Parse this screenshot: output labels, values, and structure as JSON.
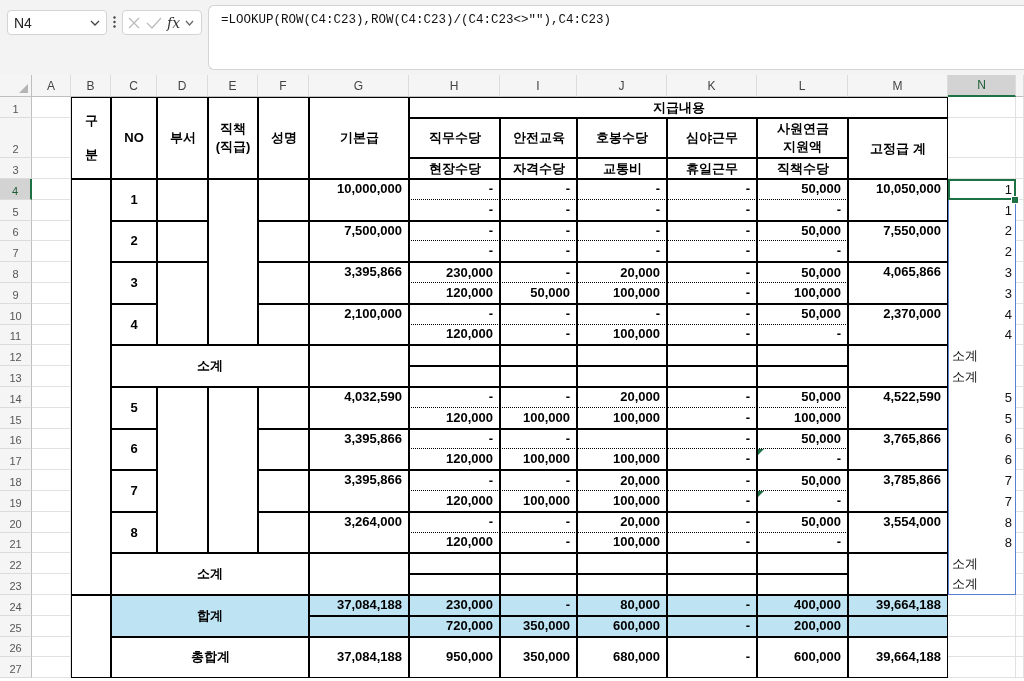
{
  "formula_bar": {
    "name_box": "N4",
    "function_label": "fx",
    "formula": "=LOOKUP(ROW(C4:C23),ROW(C4:C23)/(C4:C23<>\"\"),C4:C23)"
  },
  "column_headers": [
    {
      "label": "A",
      "selected": false
    },
    {
      "label": "B",
      "selected": false
    },
    {
      "label": "C",
      "selected": false
    },
    {
      "label": "D",
      "selected": false
    },
    {
      "label": "E",
      "selected": false
    },
    {
      "label": "F",
      "selected": false
    },
    {
      "label": "G",
      "selected": false
    },
    {
      "label": "H",
      "selected": false
    },
    {
      "label": "I",
      "selected": false
    },
    {
      "label": "J",
      "selected": false
    },
    {
      "label": "K",
      "selected": false
    },
    {
      "label": "L",
      "selected": false
    },
    {
      "label": "M",
      "selected": false
    },
    {
      "label": "N",
      "selected": true
    }
  ],
  "row_numbers": [
    {
      "label": "1",
      "selected": false
    },
    {
      "label": "2",
      "selected": false
    },
    {
      "label": "3",
      "selected": false
    },
    {
      "label": "4",
      "selected": true
    },
    {
      "label": "5",
      "selected": false
    },
    {
      "label": "6",
      "selected": false
    },
    {
      "label": "7",
      "selected": false
    },
    {
      "label": "8",
      "selected": false
    },
    {
      "label": "9",
      "selected": false
    },
    {
      "label": "10",
      "selected": false
    },
    {
      "label": "11",
      "selected": false
    },
    {
      "label": "12",
      "selected": false
    },
    {
      "label": "13",
      "selected": false
    },
    {
      "label": "14",
      "selected": false
    },
    {
      "label": "15",
      "selected": false
    },
    {
      "label": "16",
      "selected": false
    },
    {
      "label": "17",
      "selected": false
    },
    {
      "label": "18",
      "selected": false
    },
    {
      "label": "19",
      "selected": false
    },
    {
      "label": "20",
      "selected": false
    },
    {
      "label": "21",
      "selected": false
    },
    {
      "label": "22",
      "selected": false
    },
    {
      "label": "23",
      "selected": false
    },
    {
      "label": "24",
      "selected": false
    },
    {
      "label": "25",
      "selected": false
    },
    {
      "label": "26",
      "selected": false
    },
    {
      "label": "27",
      "selected": false
    }
  ],
  "table": {
    "header": {
      "category": "구분",
      "no": "NO",
      "department": "부서",
      "position": "직책 (직급)",
      "name": "성명",
      "base_pay": "기본급",
      "payment_group": "지급내용",
      "allowances": [
        {
          "top": "직무수당",
          "bottom": "현장수당"
        },
        {
          "top": "안전교육",
          "bottom": "자격수당"
        },
        {
          "top": "호봉수당",
          "bottom": "교통비"
        },
        {
          "top": "심야근무",
          "bottom": "휴일근무"
        },
        {
          "top": "사원연금 지원액",
          "bottom": "직책수당"
        }
      ],
      "fixed_total": "고정급 계"
    },
    "groups": [
      {
        "employees": [
          {
            "no": "1",
            "base_pay": "10,000,000",
            "line1": {
              "H": "-",
              "I": "-",
              "J": "-",
              "K": "-",
              "L": "50,000"
            },
            "line2": {
              "H": "-",
              "I": "-",
              "J": "-",
              "K": "-",
              "L": "-"
            },
            "fixed_total": "10,050,000",
            "error_indicator": false
          },
          {
            "no": "2",
            "base_pay": "7,500,000",
            "line1": {
              "H": "-",
              "I": "-",
              "J": "-",
              "K": "-",
              "L": "50,000"
            },
            "line2": {
              "H": "-",
              "I": "-",
              "J": "-",
              "K": "-",
              "L": "-"
            },
            "fixed_total": "7,550,000",
            "error_indicator": false
          },
          {
            "no": "3",
            "base_pay": "3,395,866",
            "line1": {
              "H": "230,000",
              "I": "-",
              "J": "20,000",
              "K": "-",
              "L": "50,000"
            },
            "line2": {
              "H": "120,000",
              "I": "50,000",
              "J": "100,000",
              "K": "-",
              "L": "100,000"
            },
            "fixed_total": "4,065,866",
            "error_indicator": false
          },
          {
            "no": "4",
            "base_pay": "2,100,000",
            "line1": {
              "H": "-",
              "I": "-",
              "J": "-",
              "K": "-",
              "L": "50,000"
            },
            "line2": {
              "H": "120,000",
              "I": "-",
              "J": "100,000",
              "K": "-",
              "L": "-"
            },
            "fixed_total": "2,370,000",
            "error_indicator": false
          }
        ],
        "subtotal": "소계"
      },
      {
        "employees": [
          {
            "no": "5",
            "base_pay": "4,032,590",
            "line1": {
              "H": "-",
              "I": "-",
              "J": "20,000",
              "K": "-",
              "L": "50,000"
            },
            "line2": {
              "H": "120,000",
              "I": "100,000",
              "J": "100,000",
              "K": "-",
              "L": "100,000"
            },
            "fixed_total": "4,522,590",
            "error_indicator": false
          },
          {
            "no": "6",
            "base_pay": "3,395,866",
            "line1": {
              "H": "-",
              "I": "-",
              "K": "-",
              "L": "50,000"
            },
            "line2": {
              "H": "120,000",
              "I": "100,000",
              "J": "100,000",
              "K": "-",
              "L": "-"
            },
            "fixed_total": "3,765,866",
            "error_indicator": true
          },
          {
            "no": "7",
            "base_pay": "3,395,866",
            "line1": {
              "H": "-",
              "I": "-",
              "J": "20,000",
              "K": "-",
              "L": "50,000"
            },
            "line2": {
              "H": "120,000",
              "I": "100,000",
              "J": "100,000",
              "K": "-",
              "L": "-"
            },
            "fixed_total": "3,785,866",
            "error_indicator": true
          },
          {
            "no": "8",
            "base_pay": "3,264,000",
            "line1": {
              "H": "-",
              "I": "-",
              "J": "20,000",
              "K": "-",
              "L": "50,000"
            },
            "line2": {
              "H": "120,000",
              "I": "-",
              "J": "100,000",
              "K": "-",
              "L": "-"
            },
            "fixed_total": "3,554,000",
            "error_indicator": false
          }
        ],
        "subtotal": "소계"
      }
    ],
    "total": {
      "label": "합계",
      "base_pay": "37,084,188",
      "line1": {
        "H": "230,000",
        "I": "-",
        "J": "80,000",
        "K": "-",
        "L": "400,000"
      },
      "line2": {
        "H": "720,000",
        "I": "350,000",
        "J": "600,000",
        "K": "-",
        "L": "200,000"
      },
      "fixed_total": "39,664,188"
    },
    "grand_total": {
      "label": "총합계",
      "base_pay": "37,084,188",
      "values": {
        "H": "950,000",
        "I": "350,000",
        "J": "680,000",
        "K": "-",
        "L": "600,000"
      },
      "fixed_total": "39,664,188"
    }
  },
  "helper_column": [
    {
      "value": "1",
      "kind": "number",
      "selected": true
    },
    {
      "value": "1",
      "kind": "number",
      "selected": false
    },
    {
      "value": "2",
      "kind": "number",
      "selected": false
    },
    {
      "value": "2",
      "kind": "number",
      "selected": false
    },
    {
      "value": "3",
      "kind": "number",
      "selected": false
    },
    {
      "value": "3",
      "kind": "number",
      "selected": false
    },
    {
      "value": "4",
      "kind": "number",
      "selected": false
    },
    {
      "value": "4",
      "kind": "number",
      "selected": false
    },
    {
      "value": "소계",
      "kind": "text",
      "selected": false
    },
    {
      "value": "소계",
      "kind": "text",
      "selected": false
    },
    {
      "value": "5",
      "kind": "number",
      "selected": false
    },
    {
      "value": "5",
      "kind": "number",
      "selected": false
    },
    {
      "value": "6",
      "kind": "number",
      "selected": false
    },
    {
      "value": "6",
      "kind": "number",
      "selected": false
    },
    {
      "value": "7",
      "kind": "number",
      "selected": false
    },
    {
      "value": "7",
      "kind": "number",
      "selected": false
    },
    {
      "value": "8",
      "kind": "number",
      "selected": false
    },
    {
      "value": "8",
      "kind": "number",
      "selected": false
    },
    {
      "value": "소계",
      "kind": "text",
      "selected": false
    },
    {
      "value": "소계",
      "kind": "text",
      "selected": false
    }
  ]
}
